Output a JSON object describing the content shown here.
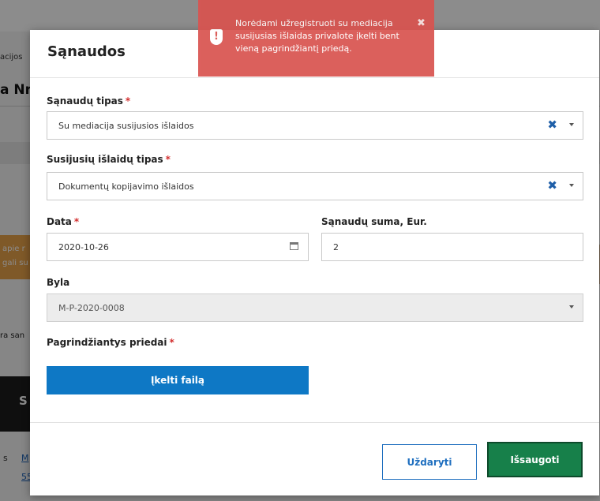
{
  "background": {
    "breadcrumb_fragment": "acijos",
    "title_fragment": "a Nr.",
    "orange_line1": "apie r",
    "orange_line2": "gali su",
    "text_fragment": "ra san",
    "dark_button_fragment": "S",
    "footer_fragment_1": "s",
    "footer_link_1": "M",
    "footer_link_2": "55"
  },
  "modal": {
    "title": "Sąnaudos",
    "fields": {
      "expense_type": {
        "label": "Sąnaudų tipas",
        "value": "Su mediacija susijusios išlaidos"
      },
      "related_expense_type": {
        "label": "Susijusių išlaidų tipas",
        "value": "Dokumentų kopijavimo išlaidos"
      },
      "date": {
        "label": "Data",
        "value": "2020-10-26"
      },
      "amount": {
        "label": "Sąnaudų suma, Eur.",
        "value": "2"
      },
      "case": {
        "label": "Byla",
        "value": "M-P-2020-0008"
      },
      "attachments": {
        "label": "Pagrindžiantys priedai"
      }
    },
    "required_marker": "*",
    "upload_button": "Įkelti failą",
    "close_button": "Uždaryti",
    "save_button": "Išsaugoti"
  },
  "toast": {
    "message": "Norėdami užregistruoti su mediacija susijusias išlaidas privalote įkelti bent vieną pagrindžiantį priedą.",
    "icon": "exclamation-shield-icon",
    "icon_glyph": "!",
    "close_glyph": "✖"
  },
  "colors": {
    "toast_bg": "#d9534f",
    "primary_blue": "#0e78c5",
    "save_green": "#17804a",
    "required_red": "#d32f2f"
  }
}
